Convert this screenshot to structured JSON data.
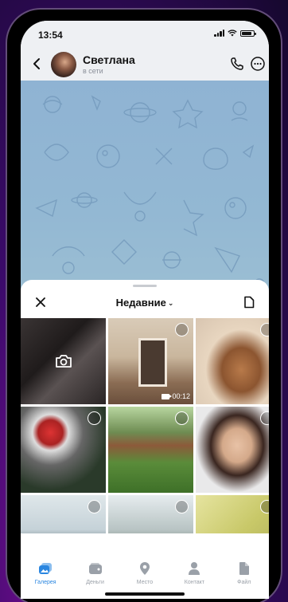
{
  "status": {
    "time": "13:54"
  },
  "chat": {
    "name": "Светлана",
    "status": "в сети"
  },
  "sheet": {
    "title": "Недавние"
  },
  "grid": {
    "video_duration": "00:12"
  },
  "tabs": [
    {
      "label": "Галерея",
      "icon": "gallery-icon",
      "active": true
    },
    {
      "label": "Деньги",
      "icon": "wallet-icon",
      "active": false
    },
    {
      "label": "Место",
      "icon": "location-icon",
      "active": false
    },
    {
      "label": "Контакт",
      "icon": "contact-icon",
      "active": false
    },
    {
      "label": "Файл",
      "icon": "file-icon",
      "active": false
    }
  ],
  "colors": {
    "accent": "#2a86e0",
    "inactive": "#9aa0a8"
  }
}
